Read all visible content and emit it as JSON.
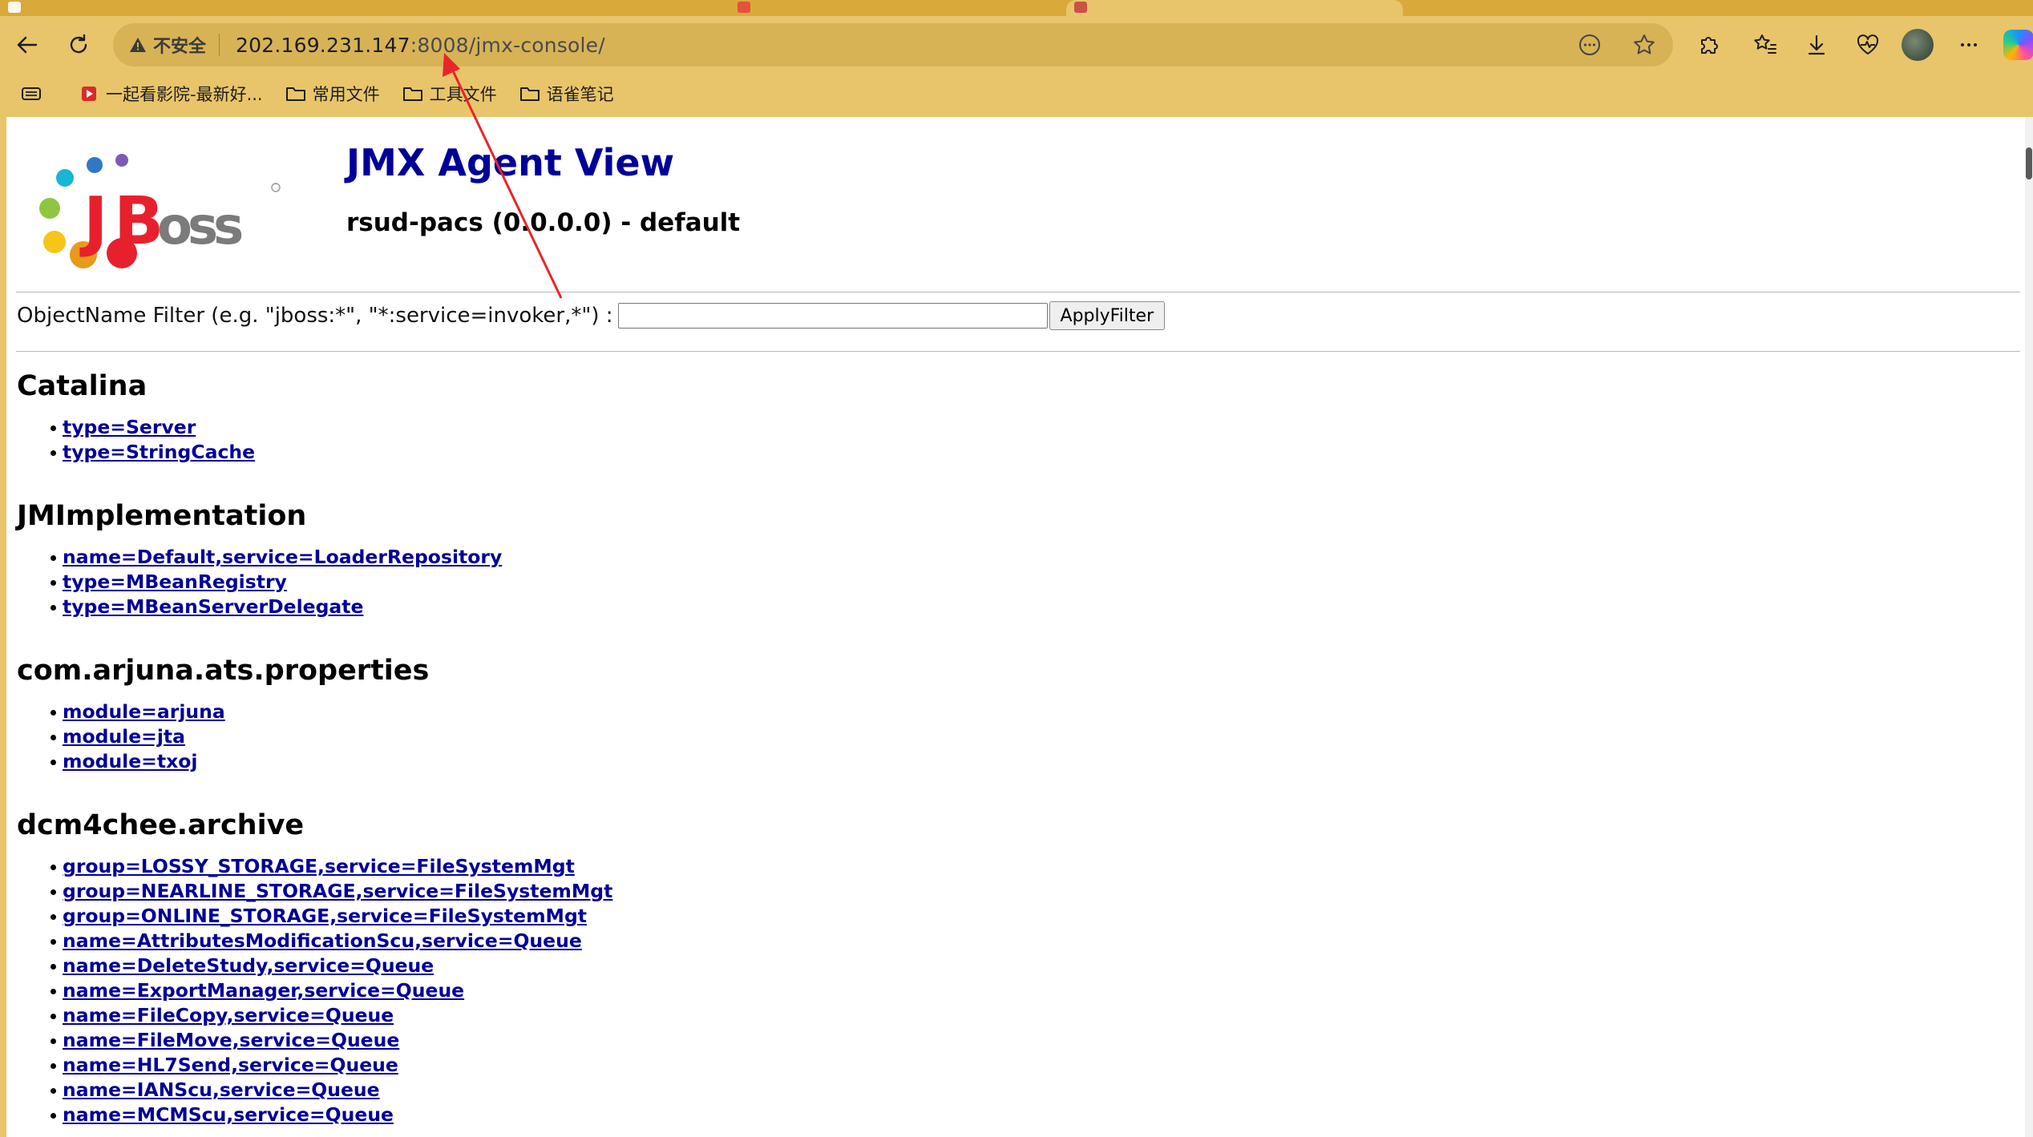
{
  "browser": {
    "address": {
      "security_label": "不安全",
      "url_host": "202.169.231.147",
      "url_rest": ":8008/jmx-console/"
    },
    "bookmarks": [
      {
        "label": "一起看影院-最新好..."
      },
      {
        "label": "常用文件"
      },
      {
        "label": "工具文件"
      },
      {
        "label": "语雀笔记"
      }
    ],
    "colors": {
      "chrome": "#e8c56a",
      "tabstrip": "#d9aa3a",
      "annotation_arrow": "#e8262a"
    }
  },
  "page": {
    "title": "JMX Agent View",
    "subtitle": "rsud-pacs (0.0.0.0) - default",
    "logo_alt": "JBoss",
    "filter": {
      "label": "ObjectName Filter (e.g. \"jboss:*\", \"*:service=invoker,*\") :",
      "value": "",
      "button_label": "ApplyFilter"
    },
    "domains": [
      {
        "name": "Catalina",
        "mbeans": [
          "type=Server",
          "type=StringCache"
        ]
      },
      {
        "name": "JMImplementation",
        "mbeans": [
          "name=Default,service=LoaderRepository",
          "type=MBeanRegistry",
          "type=MBeanServerDelegate"
        ]
      },
      {
        "name": "com.arjuna.ats.properties",
        "mbeans": [
          "module=arjuna",
          "module=jta",
          "module=txoj"
        ]
      },
      {
        "name": "dcm4chee.archive",
        "mbeans": [
          "group=LOSSY_STORAGE,service=FileSystemMgt",
          "group=NEARLINE_STORAGE,service=FileSystemMgt",
          "group=ONLINE_STORAGE,service=FileSystemMgt",
          "name=AttributesModificationScu,service=Queue",
          "name=DeleteStudy,service=Queue",
          "name=ExportManager,service=Queue",
          "name=FileCopy,service=Queue",
          "name=FileMove,service=Queue",
          "name=HL7Send,service=Queue",
          "name=IANScu,service=Queue",
          "name=MCMScu,service=Queue"
        ]
      }
    ]
  }
}
